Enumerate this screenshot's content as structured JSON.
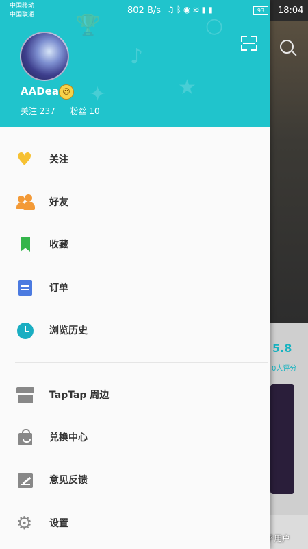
{
  "status_bar": {
    "carrier1": "中国移动",
    "carrier2": "中国联通",
    "net_speed": "802 B/s",
    "battery": "93",
    "time": "18:04"
  },
  "profile": {
    "username": "AADead",
    "following_label": "关注 237",
    "fans_label": "粉丝 10"
  },
  "menu": {
    "items": [
      {
        "label": "关注",
        "icon": "heart-icon"
      },
      {
        "label": "好友",
        "icon": "friends-icon"
      },
      {
        "label": "收藏",
        "icon": "bookmark-icon"
      },
      {
        "label": "订单",
        "icon": "order-icon"
      },
      {
        "label": "浏览历史",
        "icon": "clock-icon"
      }
    ],
    "items2": [
      {
        "label": "TapTap 周边",
        "icon": "store-icon"
      },
      {
        "label": "兑换中心",
        "icon": "bag-icon"
      },
      {
        "label": "意见反馈",
        "icon": "feedback-icon"
      },
      {
        "label": "设置",
        "icon": "gear-icon"
      }
    ]
  },
  "background": {
    "score": "5.8",
    "rated_label": "0人评分",
    "watermark": "知乎用户"
  },
  "colors": {
    "header": "#20c4cc",
    "heart": "#f6c133",
    "friends": "#f39a37",
    "bookmark": "#34b54b",
    "order": "#4b7ae0",
    "history": "#1aaec2"
  }
}
